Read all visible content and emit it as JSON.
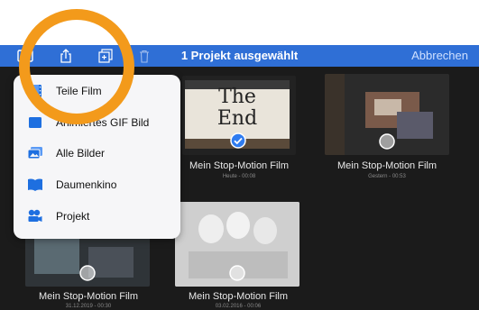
{
  "header": {
    "title": "1 Projekt ausgewählt",
    "cancel_label": "Abbrechen"
  },
  "toolbar_icons": [
    "play-icon",
    "share-icon",
    "duplicate-icon",
    "trash-icon"
  ],
  "share_menu": {
    "items": [
      {
        "label": "Teile Film",
        "icon": "film-icon"
      },
      {
        "label": "Animiertes GIF Bild",
        "icon": "gif-icon"
      },
      {
        "label": "Alle Bilder",
        "icon": "images-icon"
      },
      {
        "label": "Daumenkino",
        "icon": "book-icon"
      },
      {
        "label": "Projekt",
        "icon": "project-camera-icon"
      }
    ]
  },
  "projects": [
    {
      "title": "Mein Stop-Motion Film",
      "date": "Heute - 00:08",
      "selected": true,
      "thumb_text": "The End"
    },
    {
      "title": "Mein Stop-Motion Film",
      "date": "Gestern - 00:53",
      "selected": false
    },
    {
      "title": "Mein Stop-Motion Film",
      "date": "31.12.2019 - 00:30",
      "selected": false
    },
    {
      "title": "Mein Stop-Motion Film",
      "date": "03.02.2016 - 00:06",
      "selected": false
    }
  ],
  "colors": {
    "header_bg": "#2f6fd6",
    "content_bg": "#1b1b1b",
    "menu_icon": "#1e6fe0",
    "highlight_ring": "#f39a1b"
  }
}
